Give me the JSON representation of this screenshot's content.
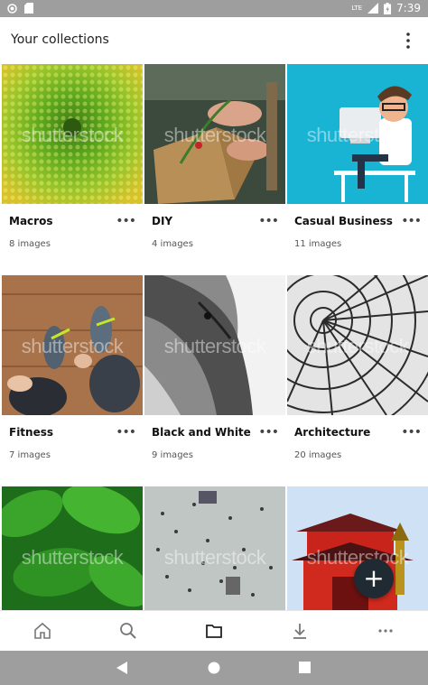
{
  "status_bar": {
    "time": "7:39",
    "network": "LTE"
  },
  "app_bar": {
    "title": "Your collections",
    "menu_icon": "more-vert-icon"
  },
  "watermark": "shutterstock",
  "collections": [
    {
      "title": "Macros",
      "count": "8 images",
      "image": "succulent-macro"
    },
    {
      "title": "DIY",
      "count": "4 images",
      "image": "gift-wrapping"
    },
    {
      "title": "Casual Business",
      "count": "11 images",
      "image": "desk-illustration"
    },
    {
      "title": "Fitness",
      "count": "7 images",
      "image": "sneakers-wood-floor"
    },
    {
      "title": "Black and White",
      "count": "9 images",
      "image": "horse-bw"
    },
    {
      "title": "Architecture",
      "count": "20 images",
      "image": "glass-dome"
    },
    {
      "title": "",
      "count": "",
      "image": "green-leaves"
    },
    {
      "title": "",
      "count": "",
      "image": "crowd-aerial"
    },
    {
      "title": "",
      "count": "",
      "image": "red-temple"
    }
  ],
  "more_label": "•••",
  "fab": {
    "label": "+",
    "icon": "add-icon"
  },
  "bottom_nav": [
    {
      "name": "home-icon"
    },
    {
      "name": "search-icon"
    },
    {
      "name": "collections-icon"
    },
    {
      "name": "download-icon"
    },
    {
      "name": "more-horiz-icon"
    }
  ],
  "colors": {
    "status_bar": "#9e9e9e",
    "fab": "#1f2a33",
    "active_nav": "#222222"
  }
}
